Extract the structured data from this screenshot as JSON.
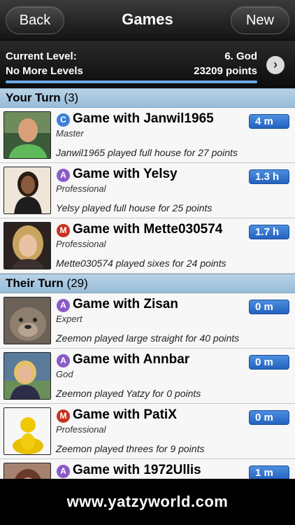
{
  "nav": {
    "back_label": "Back",
    "title": "Games",
    "new_label": "New"
  },
  "level": {
    "current_label": "Current Level:",
    "next_label": "No More Levels",
    "current_value": "6. God",
    "points": "23209 points",
    "progress": 1.0
  },
  "sections": [
    {
      "title": "Your Turn",
      "count": "(3)",
      "games": [
        {
          "mode": "C",
          "mode_color": "#3f7fd8",
          "title": "Game with Janwil1965",
          "rank": "Master",
          "last_move": "Janwil1965 played full house for 27 points",
          "time": "4 m",
          "avatar": "man-green-shirt"
        },
        {
          "mode": "A",
          "mode_color": "#8a5bc7",
          "title": "Game with Yelsy",
          "rank": "Professional",
          "last_move": "Yelsy played full house for 25 points",
          "time": "1.3 h",
          "avatar": "woman-dark-hair"
        },
        {
          "mode": "M",
          "mode_color": "#c8321f",
          "title": "Game with Mette030574",
          "rank": "Professional",
          "last_move": "Mette030574 played sixes for 24 points",
          "time": "1.7 h",
          "avatar": "woman-blonde"
        }
      ]
    },
    {
      "title": "Their Turn",
      "count": "(29)",
      "games": [
        {
          "mode": "A",
          "mode_color": "#8a5bc7",
          "title": "Game with Zisan",
          "rank": "Expert",
          "last_move": "Zeemon played large straight for 40 points",
          "time": "0 m",
          "avatar": "bulldog"
        },
        {
          "mode": "A",
          "mode_color": "#8a5bc7",
          "title": "Game with Annbar",
          "rank": "God",
          "last_move": "Zeemon played Yatzy for 0 points",
          "time": "0 m",
          "avatar": "woman-blonde-outdoor"
        },
        {
          "mode": "M",
          "mode_color": "#c8321f",
          "title": "Game with PatiX",
          "rank": "Professional",
          "last_move": "Zeemon played threes for 9 points",
          "time": "0 m",
          "avatar": "default-yellow-person"
        },
        {
          "mode": "A",
          "mode_color": "#8a5bc7",
          "title": "Game with 1972Ullis",
          "rank": "",
          "last_move": "",
          "time": "1 m",
          "avatar": "woman-partial"
        }
      ]
    }
  ],
  "footer": {
    "text": "www.yatzyworld.com"
  }
}
